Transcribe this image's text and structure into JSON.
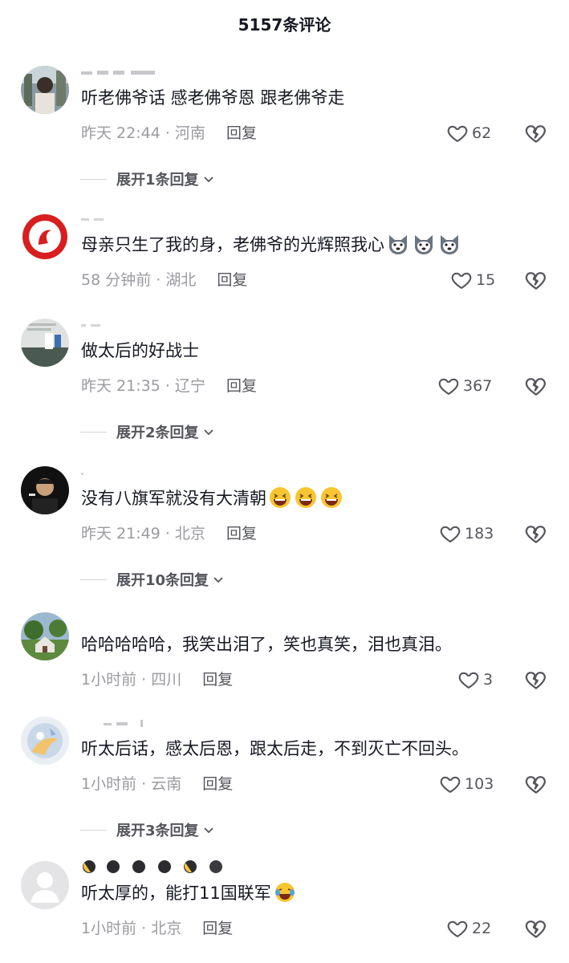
{
  "header": {
    "title": "5157条评论"
  },
  "comments": [
    {
      "text": "听老佛爷话 感老佛爷恩 跟老佛爷走",
      "time": "昨天 22:44",
      "location": "河南",
      "reply": "回复",
      "likes": "62",
      "expand": "展开1条回复"
    },
    {
      "text": "母亲只生了我的身，老佛爷的光辉照我心",
      "time": "58 分钟前",
      "location": "湖北",
      "reply": "回复",
      "likes": "15",
      "emojis": [
        "dog-face-icon",
        "dog-face-icon",
        "dog-face-icon"
      ]
    },
    {
      "text": "做太后的好战士",
      "time": "昨天 21:35",
      "location": "辽宁",
      "reply": "回复",
      "likes": "367",
      "expand": "展开2条回复"
    },
    {
      "text": "没有八旗军就没有大清朝",
      "time": "昨天 21:49",
      "location": "北京",
      "reply": "回复",
      "likes": "183",
      "expand": "展开10条回复",
      "emojis": [
        "laughing-face-icon",
        "laughing-face-icon",
        "laughing-face-icon"
      ]
    },
    {
      "text": "哈哈哈哈哈，我笑出泪了，笑也真笑，泪也真泪。",
      "time": "1小时前",
      "location": "四川",
      "reply": "回复",
      "likes": "3"
    },
    {
      "text": "听太后话，感太后恩，跟太后走，不到灭亡不回头。",
      "time": "1小时前",
      "location": "云南",
      "reply": "回复",
      "likes": "103",
      "expand": "展开3条回复"
    },
    {
      "text": "听太厚的，能打11国联军",
      "time": "1小时前",
      "location": "北京",
      "reply": "回复",
      "likes": "22",
      "emojis": [
        "tears-of-joy-icon"
      ]
    }
  ]
}
